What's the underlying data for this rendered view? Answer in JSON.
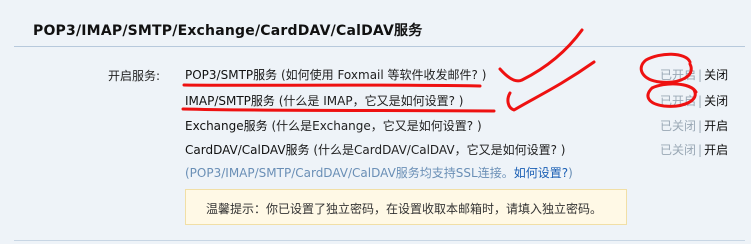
{
  "section": {
    "title": "POP3/IMAP/SMTP/Exchange/CardDAV/CalDAV服务"
  },
  "label": "开启服务:",
  "services": [
    {
      "name": "POP3/SMTP服务",
      "help_pre": " (如何使用 Foxmail 等软件收发邮件? )",
      "status": "已开启",
      "action": "关闭"
    },
    {
      "name": "IMAP/SMTP服务",
      "help_pre": " (什么是 IMAP，它又是如何设置? )",
      "status": "已开启",
      "action": "关闭"
    },
    {
      "name": "Exchange服务",
      "help_pre": " (什么是Exchange，它又是如何设置? )",
      "status": "已关闭",
      "action": "开启"
    },
    {
      "name": "CardDAV/CalDAV服务",
      "help_pre": " (什么是CardDAV/CalDAV，它又是如何设置? )",
      "status": "已关闭",
      "action": "开启"
    }
  ],
  "ssl_note": {
    "text": "(POP3/IMAP/SMTP/CardDAV/CalDAV服务均支持SSL连接。",
    "link": "如何设置?",
    "close": ")"
  },
  "separator": "|",
  "tip": "温馨提示：你已设置了独立密码，在设置收取本邮箱时，请填入独立密码。",
  "colors": {
    "annotation": "#e11",
    "background": "#eef3f8",
    "tip_bg": "#fff9e6"
  }
}
